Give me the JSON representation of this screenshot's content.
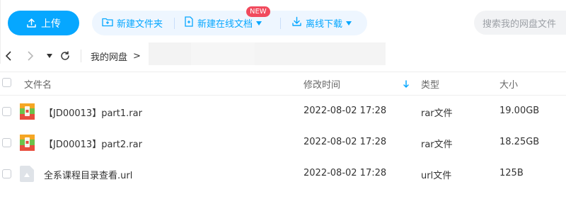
{
  "toolbar": {
    "upload_label": "上传",
    "new_folder_label": "新建文件夹",
    "new_online_doc_label": "新建在线文档",
    "new_badge": "NEW",
    "offline_download_label": "离线下载",
    "search_placeholder": "搜索我的网盘文件"
  },
  "nav": {
    "breadcrumb_root": "我的网盘",
    "breadcrumb_separator": ">"
  },
  "table": {
    "columns": {
      "name": "文件名",
      "modified": "修改时间",
      "type": "类型",
      "size": "大小"
    },
    "sort_column": "modified",
    "rows": [
      {
        "name": "【JD00013】part1.rar",
        "modified": "2022-08-02 17:28",
        "type": "rar文件",
        "size": "19.00GB",
        "icon": "archive-icon"
      },
      {
        "name": "【JD00013】part2.rar",
        "modified": "2022-08-02 17:28",
        "type": "rar文件",
        "size": "18.25GB",
        "icon": "archive-icon"
      },
      {
        "name": "全系课程目录查看.url",
        "modified": "2022-08-02 17:28",
        "type": "url文件",
        "size": "125B",
        "icon": "url-file-icon"
      }
    ]
  },
  "colors": {
    "accent": "#06a7ff",
    "accent_light_bg": "#eef6ff",
    "badge": "#f14a5d",
    "archive_orange": "#f5a623",
    "archive_green": "#6cc24a",
    "archive_red": "#e84c3d"
  }
}
